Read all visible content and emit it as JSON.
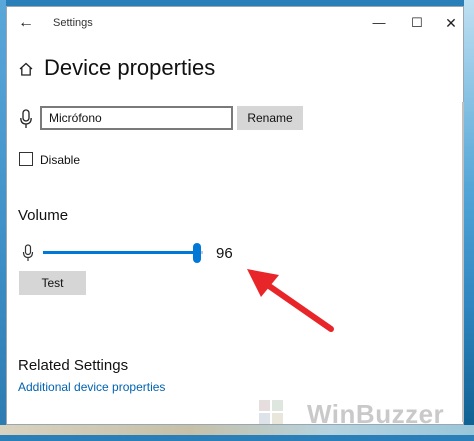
{
  "window": {
    "title": "Settings",
    "back_glyph": "←",
    "minimize_glyph": "—",
    "maximize_glyph": "☐",
    "close_glyph": "✕"
  },
  "page": {
    "title": "Device properties",
    "home_icon": "home-icon"
  },
  "device": {
    "name_value": "Micrófono",
    "rename_label": "Rename",
    "mic_icon": "microphone-icon"
  },
  "disable": {
    "label": "Disable",
    "checked": false
  },
  "volume": {
    "heading": "Volume",
    "value": 96,
    "max": 100,
    "value_text": "96",
    "test_label": "Test",
    "accent_color": "#0078d7"
  },
  "related": {
    "heading": "Related Settings",
    "link_label": "Additional device properties",
    "link_color": "#0063b1"
  },
  "annotation": {
    "arrow_color": "#e8262a"
  },
  "watermark": {
    "text": "WinBuzzer"
  }
}
